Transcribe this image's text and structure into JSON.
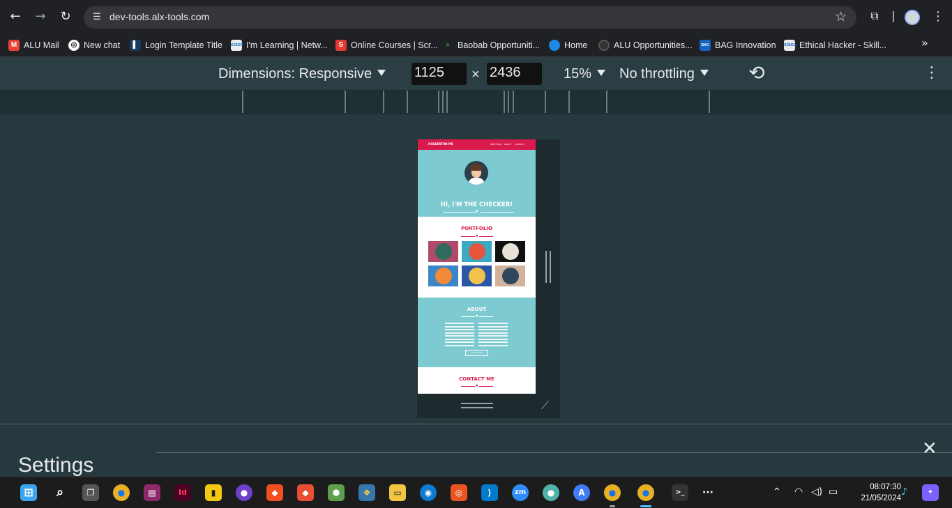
{
  "browser": {
    "url": "dev-tools.alx-tools.com",
    "bookmarks": [
      {
        "label": "ALU Mail",
        "icon": "gmail-icon",
        "color": "#ea4335"
      },
      {
        "label": "New chat",
        "icon": "openai-icon",
        "color": "#ffffff"
      },
      {
        "label": "Login Template Title",
        "icon": "figure-icon",
        "color": "#1a73e8"
      },
      {
        "label": "I'm Learning | Netw...",
        "icon": "cisco-icon",
        "color": "#e8eaed"
      },
      {
        "label": "Online Courses | Scr...",
        "icon": "scrimba-icon",
        "color": "#e53935"
      },
      {
        "label": "Baobab Opportuniti...",
        "icon": "baobab-icon",
        "color": "#2e7d32"
      },
      {
        "label": "Home",
        "icon": "salesforce-cloud-icon",
        "color": "#1e88e5"
      },
      {
        "label": "ALU Opportunities...",
        "icon": "circle-icon",
        "color": "#333333"
      },
      {
        "label": "BAG Innovation",
        "icon": "bag-icon",
        "color": "#1565c0"
      },
      {
        "label": "Ethical Hacker - Skill...",
        "icon": "cisco-icon",
        "color": "#e8eaed"
      }
    ]
  },
  "device_toolbar": {
    "dimensions_label": "Dimensions: Responsive",
    "width": "1125",
    "times": "×",
    "height": "2436",
    "zoom": "15%",
    "throttling": "No throttling"
  },
  "preview": {
    "brand": "HOLBERTON ME",
    "nav_links": [
      "PORTFOLIO",
      "ABOUT",
      "CONTACT"
    ],
    "hero_title": "HI, I'M THE CHECKER!",
    "portfolio_title": "PORTFOLIO",
    "tiles": [
      {
        "name": "cabin-tile",
        "bg": "#b04a6a",
        "circle": "#2e6b5e"
      },
      {
        "name": "cake-tile",
        "bg": "#3aa9c2",
        "circle": "#e5553d"
      },
      {
        "name": "circus-tile",
        "bg": "#111111",
        "circle": "#e7e1d7"
      },
      {
        "name": "game-tile",
        "bg": "#3a86c7",
        "circle": "#f28a3a"
      },
      {
        "name": "safe-tile",
        "bg": "#2a56a6",
        "circle": "#f2c14e"
      },
      {
        "name": "submarine-tile",
        "bg": "#d2b29c",
        "circle": "#30475e"
      }
    ],
    "about_title": "ABOUT",
    "download_label": "⤓ Download",
    "contact_title": "CONTACT ME"
  },
  "settings": {
    "title": "Settings"
  },
  "taskbar": {
    "time": "08:07:30",
    "date": "21/05/2024",
    "apps": [
      {
        "name": "windows-start-icon",
        "color": "#3ba5f0",
        "glyph": "⊞"
      },
      {
        "name": "search-icon",
        "color": "#1c1c1c",
        "glyph": "⌕"
      },
      {
        "name": "task-view-icon",
        "color": "#9e9e9e",
        "glyph": "❐"
      },
      {
        "name": "chrome-icon",
        "color": "#e8b024",
        "glyph": "●"
      },
      {
        "name": "winrar-icon",
        "color": "#8e2a6b",
        "glyph": "▤"
      },
      {
        "name": "indesign-icon",
        "color": "#49021f",
        "glyph": "Id"
      },
      {
        "name": "powerbi-icon",
        "color": "#f2c811",
        "glyph": "▮"
      },
      {
        "name": "github-icon",
        "color": "#6e40c9",
        "glyph": "●"
      },
      {
        "name": "figma-icon",
        "color": "#f24e1e",
        "glyph": "◆"
      },
      {
        "name": "git-icon",
        "color": "#e84e31",
        "glyph": "◆"
      },
      {
        "name": "node-icon",
        "color": "#5fa04e",
        "glyph": "⬢"
      },
      {
        "name": "python-icon",
        "color": "#3776ab",
        "glyph": "❖"
      },
      {
        "name": "file-explorer-icon",
        "color": "#f4c542",
        "glyph": "▭"
      },
      {
        "name": "edge-icon",
        "color": "#0c7bd1",
        "glyph": "◉"
      },
      {
        "name": "ubuntu-icon",
        "color": "#e95420",
        "glyph": "◎"
      },
      {
        "name": "vscode-icon",
        "color": "#007acc",
        "glyph": "⟩"
      },
      {
        "name": "zoom-icon",
        "color": "#2d8cff",
        "glyph": "zm"
      },
      {
        "name": "pet-app-icon",
        "color": "#4fb3a9",
        "glyph": "●"
      },
      {
        "name": "app-store-icon",
        "color": "#3f7cf5",
        "glyph": "A"
      },
      {
        "name": "chrome-profile-icon",
        "color": "#e8b024",
        "glyph": "●"
      },
      {
        "name": "chrome-active-icon",
        "color": "#e8b024",
        "glyph": "●"
      },
      {
        "name": "terminal-icon",
        "color": "#333333",
        "glyph": ">_"
      },
      {
        "name": "more-icon",
        "color": "#1c1c1c",
        "glyph": "···"
      }
    ]
  }
}
